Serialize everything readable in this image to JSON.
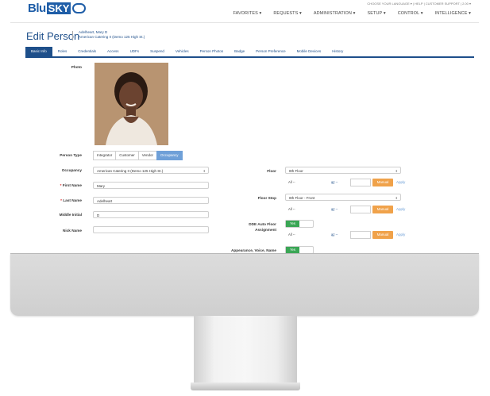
{
  "logo": {
    "blu": "Blu",
    "sky": "SKY"
  },
  "utility": "CHOOSE YOUR LANGUAGE ▾ | HELP | CUSTOMER SUPPORT | 2.00 ▾",
  "nav": [
    "FAVORITES ▾",
    "REQUESTS ▾",
    "ADMINISTRATION ▾",
    "SETUP ▾",
    "CONTROL ▾",
    "INTELLIGENCE ▾"
  ],
  "page": {
    "title": "Edit Person",
    "person_name": "Adelheart, Mary D",
    "person_org": "American Catering II (Demo 125 High St.)"
  },
  "tabs": [
    "Basic Info",
    "Roles",
    "Credentials",
    "Access",
    "UDFs",
    "Suspend",
    "Vehicles",
    "Person Photos",
    "Badge",
    "Person Preference",
    "Mobile Devices",
    "History"
  ],
  "form": {
    "photo_label": "Photo",
    "person_type_label": "Person Type",
    "person_types": [
      "Integrator",
      "Customer",
      "Vendor",
      "Occupancy"
    ],
    "person_type_selected": "Occupancy",
    "occupancy_label": "Occupancy",
    "occupancy_value": "American Catering II (Demo 125 High St.)",
    "first_name_label": "First Name",
    "first_name_value": "Mary",
    "last_name_label": "Last Name",
    "last_name_value": "Adelheart",
    "middle_initial_label": "Middle Initial",
    "middle_initial_value": "D",
    "nick_name_label": "Nick Name",
    "nick_name_value": "",
    "floor_label": "Floor",
    "floor_value": "8th Floor",
    "floor_stop_label": "Floor Stop",
    "floor_stop_value": "8th Floor - Front",
    "dde_label_1": "DDE Auto Floor",
    "dde_label_2": "Assignment",
    "appearance_label": "Appearance, Voice, Name",
    "yes": "Yes",
    "all_text": "All --",
    "manual": "Manual",
    "apply": "Apply"
  }
}
